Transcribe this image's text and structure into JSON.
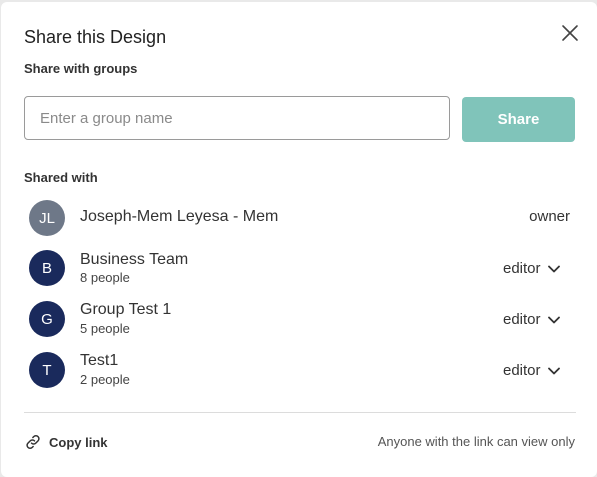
{
  "dialog": {
    "title": "Share this Design",
    "close_icon": "close-icon"
  },
  "groups_section": {
    "label": "Share with groups",
    "input_value": "",
    "input_placeholder": "Enter a group name",
    "share_label": "Share",
    "share_color": "#80c4ba"
  },
  "shared_section": {
    "label": "Shared with",
    "members": [
      {
        "initials": "JL",
        "name": "Joseph-Mem Leyesa - Mem",
        "subtitle": "",
        "role": "owner",
        "avatar_color": "#6e7888"
      },
      {
        "initials": "B",
        "name": "Business Team",
        "subtitle": "8 people",
        "role": "editor",
        "avatar_color": "#1a2a5c"
      },
      {
        "initials": "G",
        "name": "Group Test 1",
        "subtitle": "5 people",
        "role": "editor",
        "avatar_color": "#1a2a5c"
      },
      {
        "initials": "T",
        "name": "Test1",
        "subtitle": "2 people",
        "role": "editor",
        "avatar_color": "#1a2a5c"
      }
    ]
  },
  "footer": {
    "copy_link_label": "Copy link",
    "copy_link_icon": "link-icon",
    "note": "Anyone with the link can view only"
  }
}
